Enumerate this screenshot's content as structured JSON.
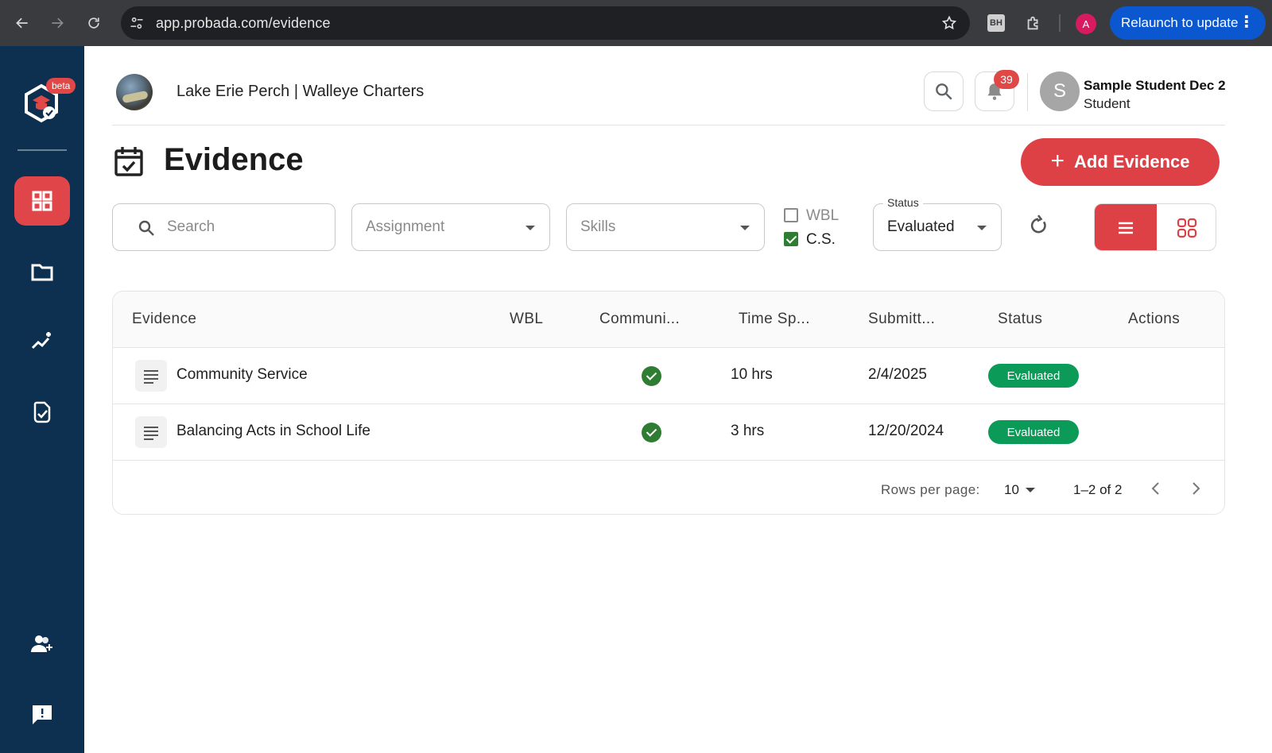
{
  "browser": {
    "url": "app.probada.com/evidence",
    "profile_initial": "A",
    "extension_label": "BH",
    "relaunch_label": "Relaunch to update"
  },
  "sidebar": {
    "beta_label": "beta",
    "items": [
      {
        "name": "dashboard",
        "icon": "grid-icon",
        "active": true
      },
      {
        "name": "portfolio",
        "icon": "folder-icon",
        "active": false
      },
      {
        "name": "growth",
        "icon": "sparkle-chart-icon",
        "active": false
      },
      {
        "name": "evidence",
        "icon": "document-check-icon",
        "active": false
      },
      {
        "name": "invite",
        "icon": "person-add-icon",
        "active": false
      },
      {
        "name": "feedback",
        "icon": "feedback-icon",
        "active": false
      }
    ]
  },
  "header": {
    "org_name": "Lake Erie Perch | Walleye Charters",
    "notification_count": "39",
    "user_initial": "S",
    "user_name": "Sample Student Dec 2",
    "user_role": "Student"
  },
  "page": {
    "title": "Evidence",
    "add_button_label": "Add Evidence"
  },
  "filters": {
    "search_placeholder": "Search",
    "assignment_placeholder": "Assignment",
    "skills_placeholder": "Skills",
    "wbl_label": "WBL",
    "wbl_checked": false,
    "cs_label": "C.S.",
    "cs_checked": true,
    "status_label": "Status",
    "status_value": "Evaluated"
  },
  "table": {
    "columns": [
      "Evidence",
      "WBL",
      "Communi...",
      "Time Sp...",
      "Submitt...",
      "Status",
      "Actions"
    ],
    "rows": [
      {
        "evidence": "Community Service",
        "wbl": "",
        "community": true,
        "time": "10 hrs",
        "submitted": "2/4/2025",
        "status": "Evaluated"
      },
      {
        "evidence": "Balancing Acts in School Life",
        "wbl": "",
        "community": true,
        "time": "3 hrs",
        "submitted": "12/20/2024",
        "status": "Evaluated"
      }
    ],
    "rows_per_page_label": "Rows per page:",
    "rows_per_page_value": "10",
    "range_label": "1–2 of 2"
  },
  "colors": {
    "sidebar_bg": "#0d3050",
    "accent_red": "#dd4146",
    "status_green": "#0c9a58",
    "check_green": "#2e7d32"
  }
}
